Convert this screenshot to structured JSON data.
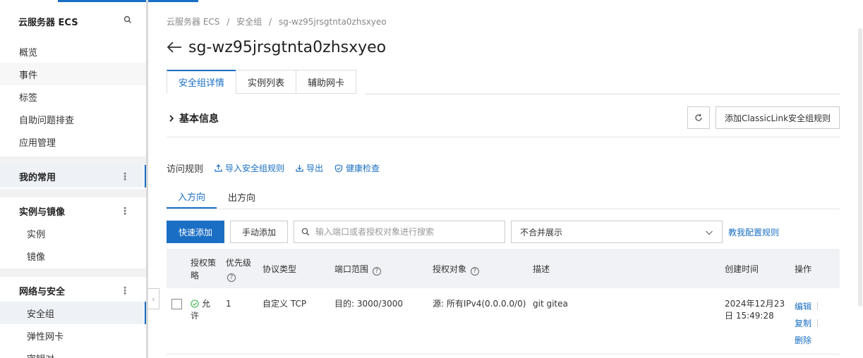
{
  "sidebar": {
    "title": "云服务器 ECS",
    "items_top": [
      "概览",
      "事件",
      "标签",
      "自助问题排查",
      "应用管理"
    ],
    "favorites_label": "我的常用",
    "instances_section": {
      "label": "实例与镜像",
      "items": [
        "实例",
        "镜像"
      ]
    },
    "network_section": {
      "label": "网络与安全",
      "items": [
        "安全组",
        "弹性网卡",
        "密钥对"
      ]
    },
    "active_item": "安全组",
    "more_glyph": "⋮",
    "collapse_glyph": "‹"
  },
  "breadcrumb": [
    "云服务器 ECS",
    "/",
    "安全组",
    "/",
    "sg-wz95jrsgtnta0zhsxyeo"
  ],
  "page_title": "sg-wz95jrsgtnta0zhsxyeo",
  "tabs": [
    "安全组详情",
    "实例列表",
    "辅助网卡"
  ],
  "basic_info": "基本信息",
  "classic_link_button": "添加ClassicLink安全组规则",
  "access_rules": {
    "label": "访问规则",
    "links": [
      "导入安全组规则",
      "导出",
      "健康检查"
    ]
  },
  "direction_tabs": [
    "入方向",
    "出方向"
  ],
  "toolbar": {
    "quick_add": "快速添加",
    "manual_add": "手动添加",
    "search_placeholder": "输入端口或者授权对象进行搜索",
    "merge_select": "不合并展示",
    "teach_link": "教我配置规则"
  },
  "table": {
    "headers": {
      "policy_l1": "授权策",
      "policy_l2": "略",
      "priority": "优先级",
      "protocol": "协议类型",
      "port": "端口范围",
      "source": "授权对象",
      "desc": "描述",
      "created": "创建时间",
      "action": "操作"
    },
    "rows": [
      {
        "policy_l1": "允",
        "policy_l2": "许",
        "priority": "1",
        "protocol": "自定义 TCP",
        "port": "目的: 3000/3000",
        "source": "源: 所有IPv4(0.0.0.0/0)",
        "desc": "git gitea",
        "created_l1": "2024年12月23",
        "created_l2": "日 15:49:28",
        "actions": [
          "编辑",
          "复制",
          "删除"
        ]
      }
    ]
  },
  "colors": {
    "accent": "#1a6fc4",
    "header_bg": "#f0f2f5",
    "allow": "#3bb346"
  }
}
